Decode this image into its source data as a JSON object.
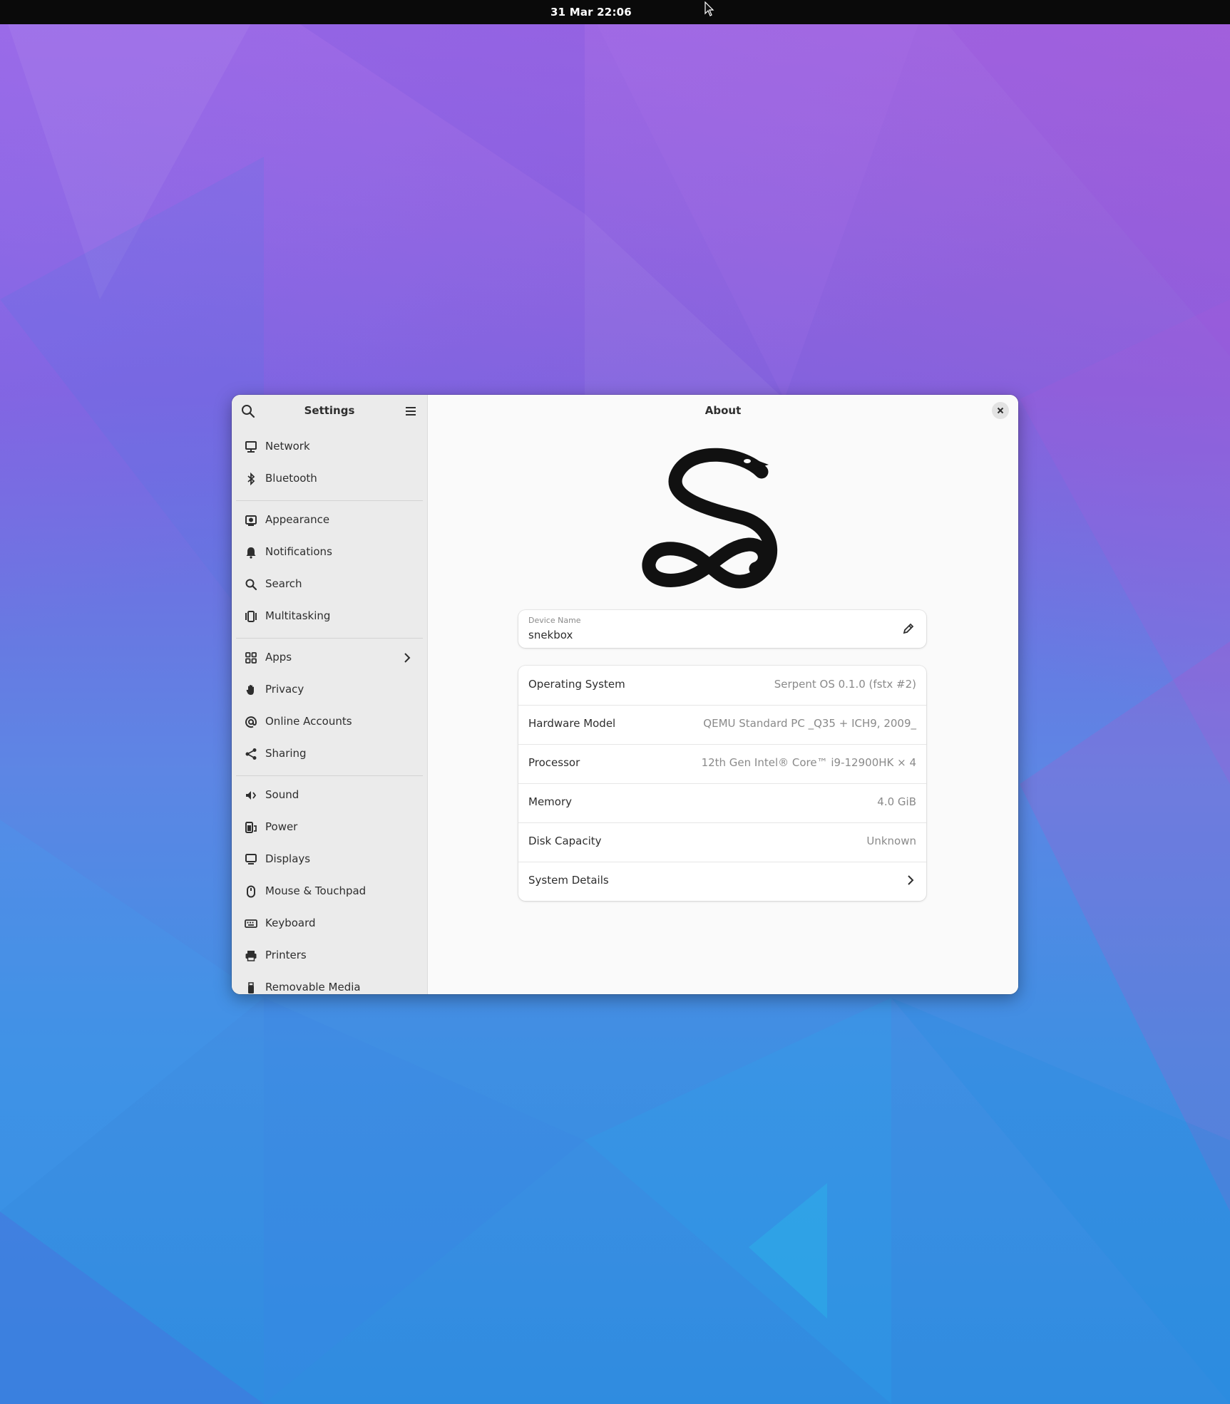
{
  "topbar": {
    "clock": "31 Mar  22:06"
  },
  "sidebar": {
    "title": "Settings",
    "items": [
      {
        "label": "Network",
        "icon": "network-icon"
      },
      {
        "label": "Bluetooth",
        "icon": "bluetooth-icon"
      },
      {
        "label": "Appearance",
        "icon": "appearance-icon"
      },
      {
        "label": "Notifications",
        "icon": "bell-icon"
      },
      {
        "label": "Search",
        "icon": "search-icon"
      },
      {
        "label": "Multitasking",
        "icon": "multitasking-icon"
      },
      {
        "label": "Apps",
        "icon": "apps-grid-icon"
      },
      {
        "label": "Privacy",
        "icon": "hand-icon"
      },
      {
        "label": "Online Accounts",
        "icon": "at-icon"
      },
      {
        "label": "Sharing",
        "icon": "share-icon"
      },
      {
        "label": "Sound",
        "icon": "speaker-icon"
      },
      {
        "label": "Power",
        "icon": "power-icon"
      },
      {
        "label": "Displays",
        "icon": "display-icon"
      },
      {
        "label": "Mouse & Touchpad",
        "icon": "mouse-icon"
      },
      {
        "label": "Keyboard",
        "icon": "keyboard-icon"
      },
      {
        "label": "Printers",
        "icon": "printer-icon"
      },
      {
        "label": "Removable Media",
        "icon": "usb-icon"
      }
    ]
  },
  "content": {
    "title": "About",
    "device": {
      "label": "Device Name",
      "value": "snekbox"
    },
    "info": [
      {
        "key": "Operating System",
        "value": "Serpent OS 0.1.0 (fstx #2)"
      },
      {
        "key": "Hardware Model",
        "value": "QEMU Standard PC _Q35 + ICH9, 2009_"
      },
      {
        "key": "Processor",
        "value": "12th Gen Intel® Core™ i9-12900HK × 4"
      },
      {
        "key": "Memory",
        "value": "4.0 GiB"
      },
      {
        "key": "Disk Capacity",
        "value": "Unknown"
      },
      {
        "key": "System Details",
        "value": ""
      }
    ]
  },
  "colors": {
    "topbar": "#0a0a0a",
    "sidebar": "#ebebeb",
    "content": "#fafafa",
    "text": "#2e2e2e",
    "dim_text": "#8a8a8a"
  }
}
